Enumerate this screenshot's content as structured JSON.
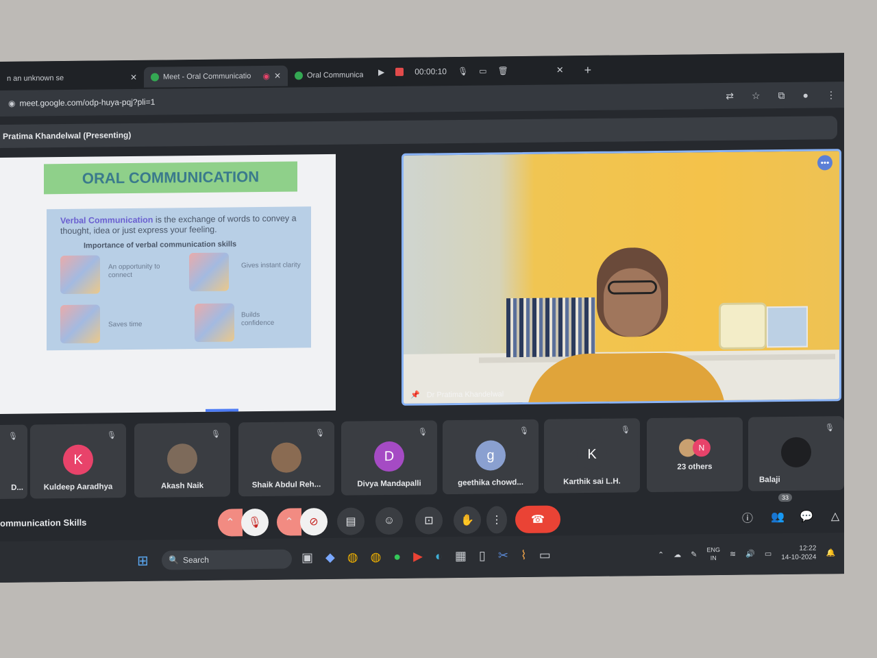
{
  "tabs": [
    {
      "title": "n an unknown se",
      "icon_color": "#9aa0a6"
    },
    {
      "title": "Meet - Oral Communicatio",
      "icon_color": "#34a853"
    },
    {
      "title": "Oral Communicat",
      "icon_color": "#34a853"
    }
  ],
  "recording": {
    "timer": "00:00:10"
  },
  "url": "meet.google.com/odp-huya-pqj?pli=1",
  "presenting_label": "Pratima Khandelwal (Presenting)",
  "slide": {
    "title": "ORAL COMMUNICATION",
    "verbal_term": "Verbal Communication",
    "verbal_rest": " is the exchange of words to convey a thought, idea or just express your feeling.",
    "importance_heading": "Importance of verbal communication skills",
    "benefits": [
      "An opportunity to connect",
      "Gives instant clarity",
      "Saves time",
      "Builds confidence"
    ]
  },
  "speaker": {
    "name": "Dr Pratima Khandelwal"
  },
  "participants": [
    {
      "name": "D...",
      "initial": "",
      "color": "#3a3d42"
    },
    {
      "name": "Kuldeep Aaradhya",
      "initial": "K",
      "color": "#e8436a"
    },
    {
      "name": "Akash Naik",
      "initial": "",
      "color": "#7d6a5a"
    },
    {
      "name": "Shaik Abdul Reh...",
      "initial": "",
      "color": "#8a6b52"
    },
    {
      "name": "Divya Mandapalli",
      "initial": "D",
      "color": "#a54bc4"
    },
    {
      "name": "geethika chowd...",
      "initial": "g",
      "color": "#8aa0d0"
    },
    {
      "name": "Karthik sai L.H.",
      "initial": "K",
      "color": "#3a3d42"
    },
    {
      "name": "23 others",
      "initial": "N",
      "color": "#e8436a"
    },
    {
      "name": "Balaji",
      "initial": "",
      "color": "#1e1f22"
    }
  ],
  "meeting_title": "ommunication Skills",
  "people_count": "33",
  "taskbar": {
    "search_placeholder": "Search",
    "lang_line1": "ENG",
    "lang_line2": "IN",
    "time": "12:22",
    "date": "14-10-2024"
  }
}
